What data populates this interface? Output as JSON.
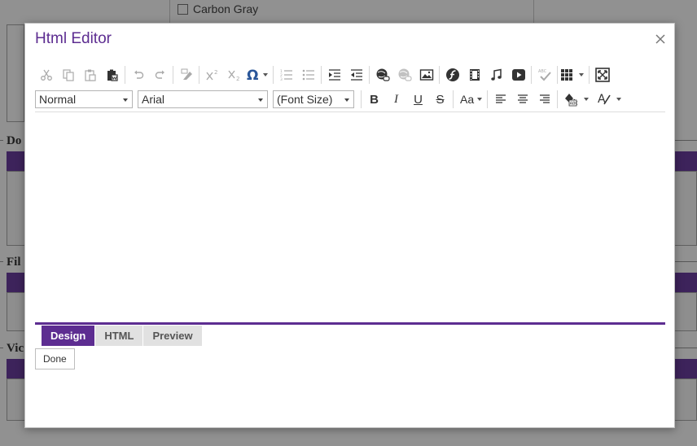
{
  "background": {
    "checkbox_label": "Carbon Gray",
    "legend_1": "Do",
    "legend_2": "Fil",
    "legend_3": "Vic",
    "accent": "#6b3fa0"
  },
  "dialog": {
    "title": "Html Editor",
    "close_icon": "close-icon"
  },
  "toolbar": {
    "row1": [
      "cut-icon",
      "copy-icon",
      "paste-icon",
      "paste-from-word-icon",
      "undo-icon",
      "redo-icon",
      "format-stripper-icon",
      "superscript-icon",
      "subscript-icon",
      "insert-symbol-icon",
      "numbered-list-icon",
      "bullet-list-icon",
      "indent-icon",
      "outdent-icon",
      "hyperlink-manager-icon",
      "remove-link-icon",
      "image-manager-icon",
      "flash-manager-icon",
      "media-manager-icon",
      "audio-icon",
      "video-icon",
      "spellcheck-icon",
      "insert-table-icon",
      "fullscreen-icon"
    ],
    "paragraph_style": "Normal",
    "font_name": "Arial",
    "font_size": "(Font Size)",
    "bold_label": "B",
    "italic_label": "I",
    "underline_label": "U",
    "strike_label": "S",
    "case_label": "Aa"
  },
  "tabs": [
    {
      "label": "Design",
      "active": true
    },
    {
      "label": "HTML",
      "active": false
    },
    {
      "label": "Preview",
      "active": false
    }
  ],
  "done_label": "Done",
  "colors": {
    "accent": "#5d2d91",
    "tab_inactive": "#e1e1e1"
  }
}
